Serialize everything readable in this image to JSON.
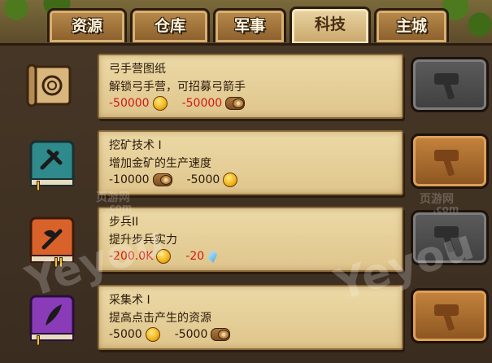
{
  "tabs": [
    "资源",
    "仓库",
    "军事",
    "科技",
    "主城"
  ],
  "active_tab": "科技",
  "items": [
    {
      "title": "弓手营图纸",
      "desc": "解锁弓手营，可招募弓箭手",
      "costs": [
        {
          "value": "-50000",
          "resource": "coin-icon",
          "insufficient": true
        },
        {
          "value": "-50000",
          "resource": "log-icon",
          "insufficient": true
        }
      ],
      "button_state": "disabled",
      "icon": "scroll-icon"
    },
    {
      "title": "挖矿技术 I",
      "desc": "增加金矿的生产速度",
      "costs": [
        {
          "value": "-10000",
          "resource": "log-icon",
          "insufficient": false
        },
        {
          "value": "-5000",
          "resource": "coin-icon",
          "insufficient": false
        }
      ],
      "button_state": "enabled",
      "icon": "pickaxe-book-icon",
      "level_badge": "I"
    },
    {
      "title": "步兵II",
      "desc": "提升步兵实力",
      "costs": [
        {
          "value": "-200.0K",
          "resource": "coin-icon",
          "insufficient": true
        },
        {
          "value": "-20",
          "resource": "gem-icon",
          "insufficient": true
        }
      ],
      "button_state": "disabled",
      "icon": "axe-book-icon",
      "level_badge": "II"
    },
    {
      "title": "采集术 I",
      "desc": "提高点击产生的资源",
      "costs": [
        {
          "value": "-5000",
          "resource": "coin-icon",
          "insufficient": false
        },
        {
          "value": "-5000",
          "resource": "log-icon",
          "insufficient": false
        }
      ],
      "button_state": "enabled",
      "icon": "feather-book-icon",
      "level_badge": "I"
    }
  ],
  "watermarks": [
    "页游网",
    ".com",
    "Yeyou"
  ],
  "colors": {
    "tab_bg": "#a67a3e",
    "tab_active_bg": "#e3cc98",
    "parchment": "#e6d09a",
    "insufficient_text": "#d11a12",
    "button_disabled": "#4d4d4d",
    "button_enabled": "#a86b2c",
    "panel_bg": "#403224"
  }
}
